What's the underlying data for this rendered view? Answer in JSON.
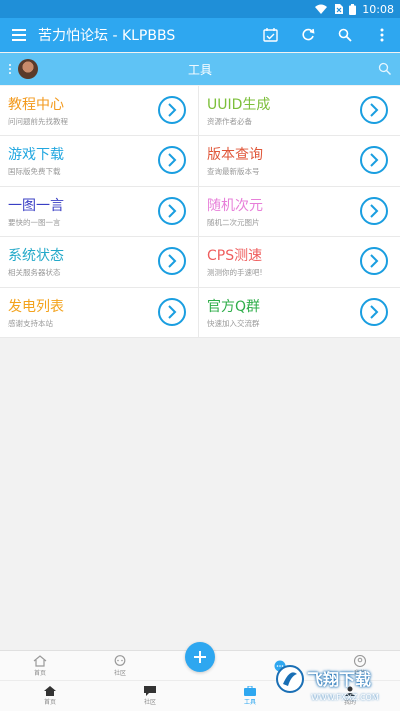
{
  "status_bar": {
    "time": "10:08"
  },
  "app_bar": {
    "title": "苦力怕论坛 - KLPBBS"
  },
  "sub_bar": {
    "title": "工具"
  },
  "tools": [
    {
      "name": "教程中心",
      "desc": "问问题前先找教程",
      "color": "#f39a1e"
    },
    {
      "name": "UUID生成",
      "desc": "资源作者必备",
      "color": "#7cbf3a"
    },
    {
      "name": "游戏下载",
      "desc": "国际版免费下载",
      "color": "#22a7e0"
    },
    {
      "name": "版本查询",
      "desc": "查询最新版本号",
      "color": "#e0573a"
    },
    {
      "name": "一图一言",
      "desc": "要快的一图一言",
      "color": "#3a3fc4"
    },
    {
      "name": "随机次元",
      "desc": "随机二次元图片",
      "color": "#e77fd9"
    },
    {
      "name": "系统状态",
      "desc": "相关服务器状态",
      "color": "#24a9c9"
    },
    {
      "name": "CPS测速",
      "desc": "测测你的手速吧!",
      "color": "#ef5e5e"
    },
    {
      "name": "发电列表",
      "desc": "感谢支持本站",
      "color": "#f3a31e"
    },
    {
      "name": "官方Q群",
      "desc": "快速加入交流群",
      "color": "#2fae4a"
    }
  ],
  "bottom_tabs_top": [
    {
      "label": "首页"
    },
    {
      "label": "社区"
    },
    {
      "label": ""
    },
    {
      "label": ""
    },
    {
      "label": "我的"
    }
  ],
  "bottom_tabs_bottom": [
    {
      "label": "首页"
    },
    {
      "label": "社区"
    },
    {
      "label": "工具"
    },
    {
      "label": "我的"
    }
  ],
  "watermark": {
    "main": "飞翔下载",
    "sub": "WWW.FXXZ.COM"
  },
  "colors": {
    "primary": "#2ea7f0",
    "primary_dark": "#1f8fd8",
    "sub_bar": "#5fc3f5",
    "arrow": "#1a9ee0"
  }
}
